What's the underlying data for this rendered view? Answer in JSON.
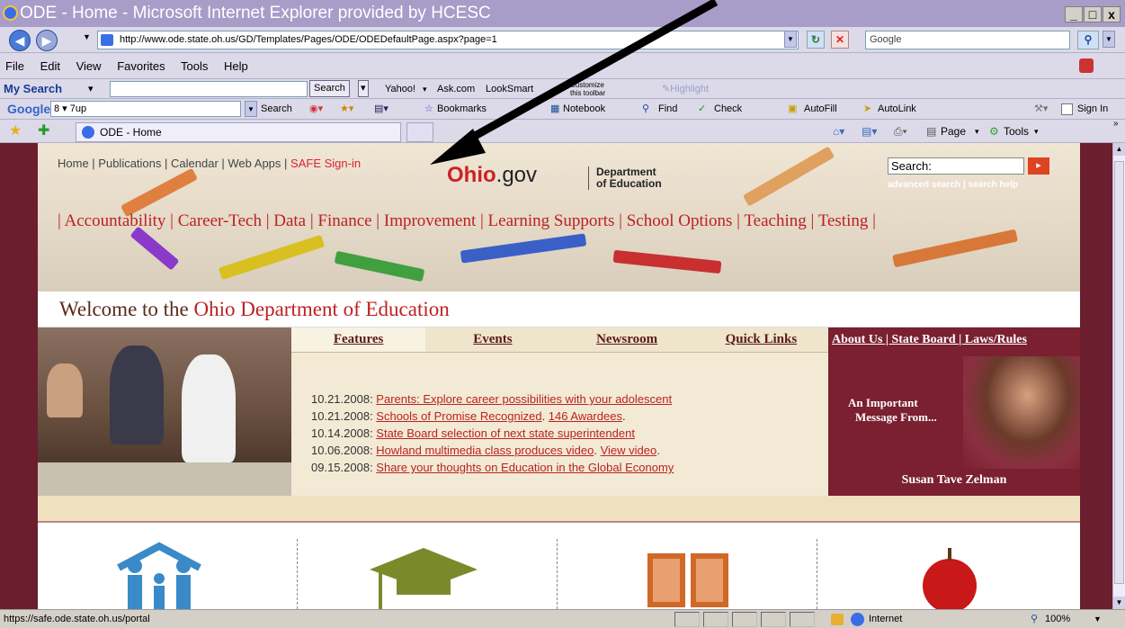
{
  "window": {
    "title": "ODE - Home - Microsoft Internet Explorer provided by HCESC",
    "min": "_",
    "max": "□",
    "close": "x"
  },
  "address": {
    "url": "http://www.ode.state.oh.us/GD/Templates/Pages/ODE/ODEDefaultPage.aspx?page=1",
    "search_placeholder": "Google"
  },
  "menu": [
    "File",
    "Edit",
    "View",
    "Favorites",
    "Tools",
    "Help"
  ],
  "toolbar1": {
    "brand": "My Search",
    "search_btn": "Search",
    "yahoo": "Yahoo!",
    "ask": "Ask.com",
    "looksmart": "LookSmart",
    "customize": "Customize this toolbar",
    "highlight": "Highlight"
  },
  "toolbar2": {
    "brand": "Google",
    "input_value": "8 ▾ 7up",
    "search": "Search",
    "bookmarks": "Bookmarks",
    "notebook": "Notebook",
    "find": "Find",
    "check": "Check",
    "autofill": "AutoFill",
    "autolink": "AutoLink",
    "signin": "Sign In"
  },
  "tabbar": {
    "tab_label": "ODE - Home",
    "page": "Page",
    "tools": "Tools"
  },
  "site": {
    "toplinks": [
      "Home",
      "Publications",
      "Calendar",
      "Web Apps"
    ],
    "safe_signin": "SAFE Sign-in",
    "logo_ohio": "Ohio",
    "logo_gov": ".gov",
    "dept": "Department",
    "dept2": "of Education",
    "search_label": "Search:",
    "advanced": "advanced search",
    "help": "search help",
    "nav": "| Accountability | Career-Tech | Data | Finance | Improvement | Learning Supports | School Options | Teaching | Testing |",
    "welcome_prefix": "Welcome to the ",
    "welcome_name": "Ohio Department of Education",
    "tabs": [
      "Features",
      "Events",
      "Newsroom",
      "Quick Links"
    ],
    "news": [
      {
        "date": "10.21.2008:",
        "parts": [
          {
            "text": "Parents: Explore career possibilities with your adolescent",
            "link": true
          }
        ]
      },
      {
        "date": "10.21.2008:",
        "parts": [
          {
            "text": "Schools of Promise Recognized",
            "link": true
          },
          {
            "text": ". ",
            "link": false
          },
          {
            "text": "146 Awardees",
            "link": true
          },
          {
            "text": ".",
            "link": false
          }
        ]
      },
      {
        "date": "10.14.2008:",
        "parts": [
          {
            "text": "State Board selection of next state superintendent",
            "link": true
          }
        ]
      },
      {
        "date": "10.06.2008:",
        "parts": [
          {
            "text": "Howland multimedia class produces video",
            "link": true
          },
          {
            "text": ". ",
            "link": false
          },
          {
            "text": "View video",
            "link": true
          },
          {
            "text": ".",
            "link": false
          }
        ]
      },
      {
        "date": "09.15.2008:",
        "parts": [
          {
            "text": "Share your thoughts on Education in the Global Economy",
            "link": true
          }
        ]
      }
    ],
    "right_links": "About Us | State Board | Laws/Rules",
    "message1": "An Important",
    "message2": "Message From...",
    "person": "Susan Tave Zelman"
  },
  "status": {
    "url": "https://safe.ode.state.oh.us/portal",
    "zone": "Internet",
    "zoom": "100%"
  },
  "colors": {
    "titlebar": "#a89cc8",
    "maroon": "#7a2030",
    "link_red": "#b22222"
  }
}
